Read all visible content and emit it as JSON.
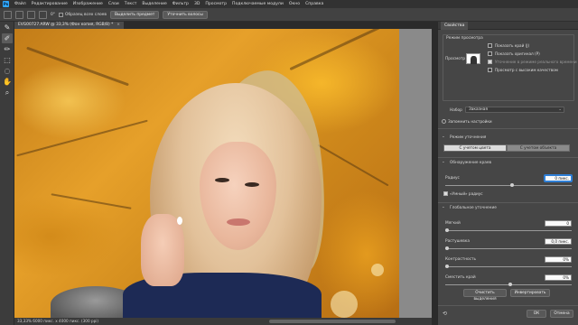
{
  "app": {
    "logo": "Ps",
    "menu": [
      "Файл",
      "Редактирование",
      "Изображение",
      "Слои",
      "Текст",
      "Выделение",
      "Фильтр",
      "3D",
      "Просмотр",
      "Подключаемые модули",
      "Окно",
      "Справка"
    ]
  },
  "options_bar": {
    "angle_value": "0°",
    "sample_all_layers": "Образец всех слоев",
    "select_subject": "Выделить предмет",
    "refine_hair": "Уточнить волосы"
  },
  "document": {
    "tab_title": "EVG00727.ARW @ 33,3% (Фон копия, RGB/8) *",
    "close_glyph": "×",
    "status": "33,33%   6000 пикс. x 4000 пикс. (300 ppi)"
  },
  "tools": [
    {
      "name": "brush-icon",
      "glyph": "✎",
      "active": false
    },
    {
      "name": "refine-edge-brush-icon",
      "glyph": "✐",
      "active": true
    },
    {
      "name": "brush-tool-icon",
      "glyph": "🖌",
      "active": false
    },
    {
      "name": "object-selection-icon",
      "glyph": "⬚",
      "active": false
    },
    {
      "name": "lasso-icon",
      "glyph": "◌",
      "active": false
    },
    {
      "name": "hand-icon",
      "glyph": "✋",
      "active": false
    },
    {
      "name": "zoom-icon",
      "glyph": "⌕",
      "active": false
    }
  ],
  "properties": {
    "tab_label": "Свойства",
    "view_mode": {
      "title": "Режим просмотра",
      "view_label": "Просмотр",
      "show_edge": "Показать край (J)",
      "show_original": "Показать оригинал (P)",
      "realtime_refine": "Уточнение в режиме реального времени",
      "high_quality": "Просмотр с высоким качеством"
    },
    "overlay": {
      "label": "Набор",
      "value": "Заказная"
    },
    "remember_settings": "Запомнить настройки",
    "refine_mode": {
      "title": "Режим уточнения",
      "color_aware": "С учетом цвета",
      "object_aware": "С учетом объекта"
    },
    "edge_detection": {
      "title": "Обнаружение краев",
      "radius_label": "Радиус",
      "radius_value": "0 пикс.",
      "smart_radius": "«Умный» радиус"
    },
    "global_refinements": {
      "title": "Глобальное уточнение",
      "smooth_label": "Мягкий",
      "smooth_value": "0",
      "feather_label": "Растушевка",
      "feather_value": "0,0 пикс.",
      "contrast_label": "Контрастность",
      "contrast_value": "0%",
      "shift_edge_label": "Сместить край",
      "shift_edge_value": "0%"
    },
    "buttons": {
      "clear_selection": "Очистить выделения",
      "invert": "Инвертировать",
      "ok": "ОК",
      "cancel": "Отмена"
    }
  }
}
